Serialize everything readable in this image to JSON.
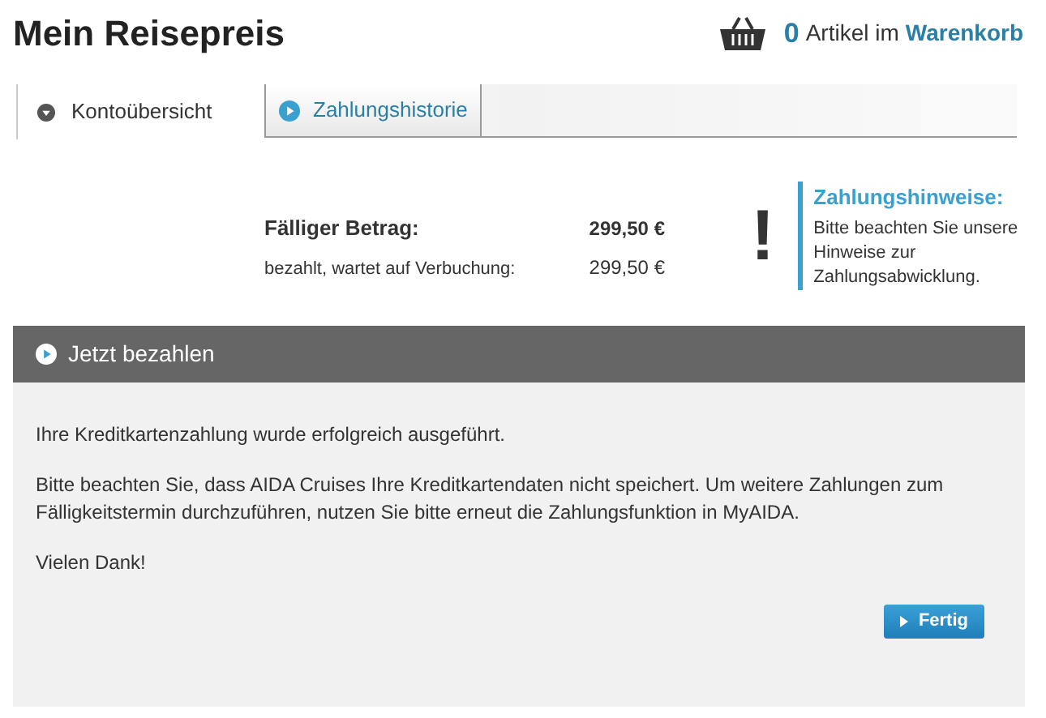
{
  "title": "Mein Reisepreis",
  "cart": {
    "count": "0",
    "text": "Artikel im",
    "link": "Warenkorb"
  },
  "tabs": [
    {
      "label": "Kontoübersicht",
      "selected": true
    },
    {
      "label": "Zahlungshistorie",
      "selected": false
    }
  ],
  "summary": [
    {
      "label": "Fälliger Betrag:",
      "value": "299,50 €",
      "kind": "total"
    },
    {
      "label": "bezahlt, wartet auf Verbuchung:",
      "value": "299,50 €",
      "kind": "pending"
    }
  ],
  "notice": {
    "mark": "!",
    "title": "Zahlungshinweise:",
    "text": "Bitte beachten Sie unsere Hinweise zur Zahlungsabwicklung."
  },
  "panel": {
    "title": "Jetzt bezahlen",
    "paragraphs": [
      "Ihre Kreditkartenzahlung wurde erfolgreich ausgeführt.",
      "Bitte beachten Sie, dass AIDA Cruises Ihre Kreditkartendaten nicht speichert. Um weitere Zahlungen zum Fälligkeitstermin durchzuführen, nutzen Sie bitte erneut die Zahlungsfunktion in MyAIDA.",
      "Vielen Dank!"
    ],
    "button": "Fertig"
  }
}
